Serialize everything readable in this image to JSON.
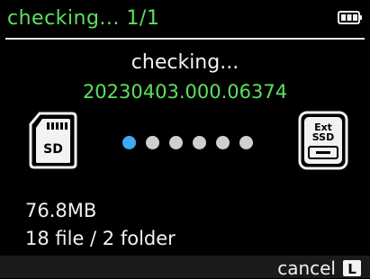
{
  "header": {
    "title": "checking... 1/1",
    "battery_icon": "battery-icon"
  },
  "status": {
    "message": "checking...",
    "file_id": "20230403.000.06374"
  },
  "source": {
    "icon": "sd-card-icon",
    "label": "SD"
  },
  "destination": {
    "icon": "external-ssd-icon",
    "label_top": "Ext",
    "label_bottom": "SSD"
  },
  "progress": {
    "dots_total": 6,
    "active_index": 0
  },
  "info": {
    "size": "76.8MB",
    "count": "18 file / 2 folder"
  },
  "footer": {
    "cancel_label": "cancel",
    "cancel_key": "L"
  },
  "colors": {
    "accent_green": "#5ee05e",
    "active_dot": "#3fa9f5",
    "inactive_dot": "#cfcfcf",
    "text": "#f2f2f2"
  }
}
